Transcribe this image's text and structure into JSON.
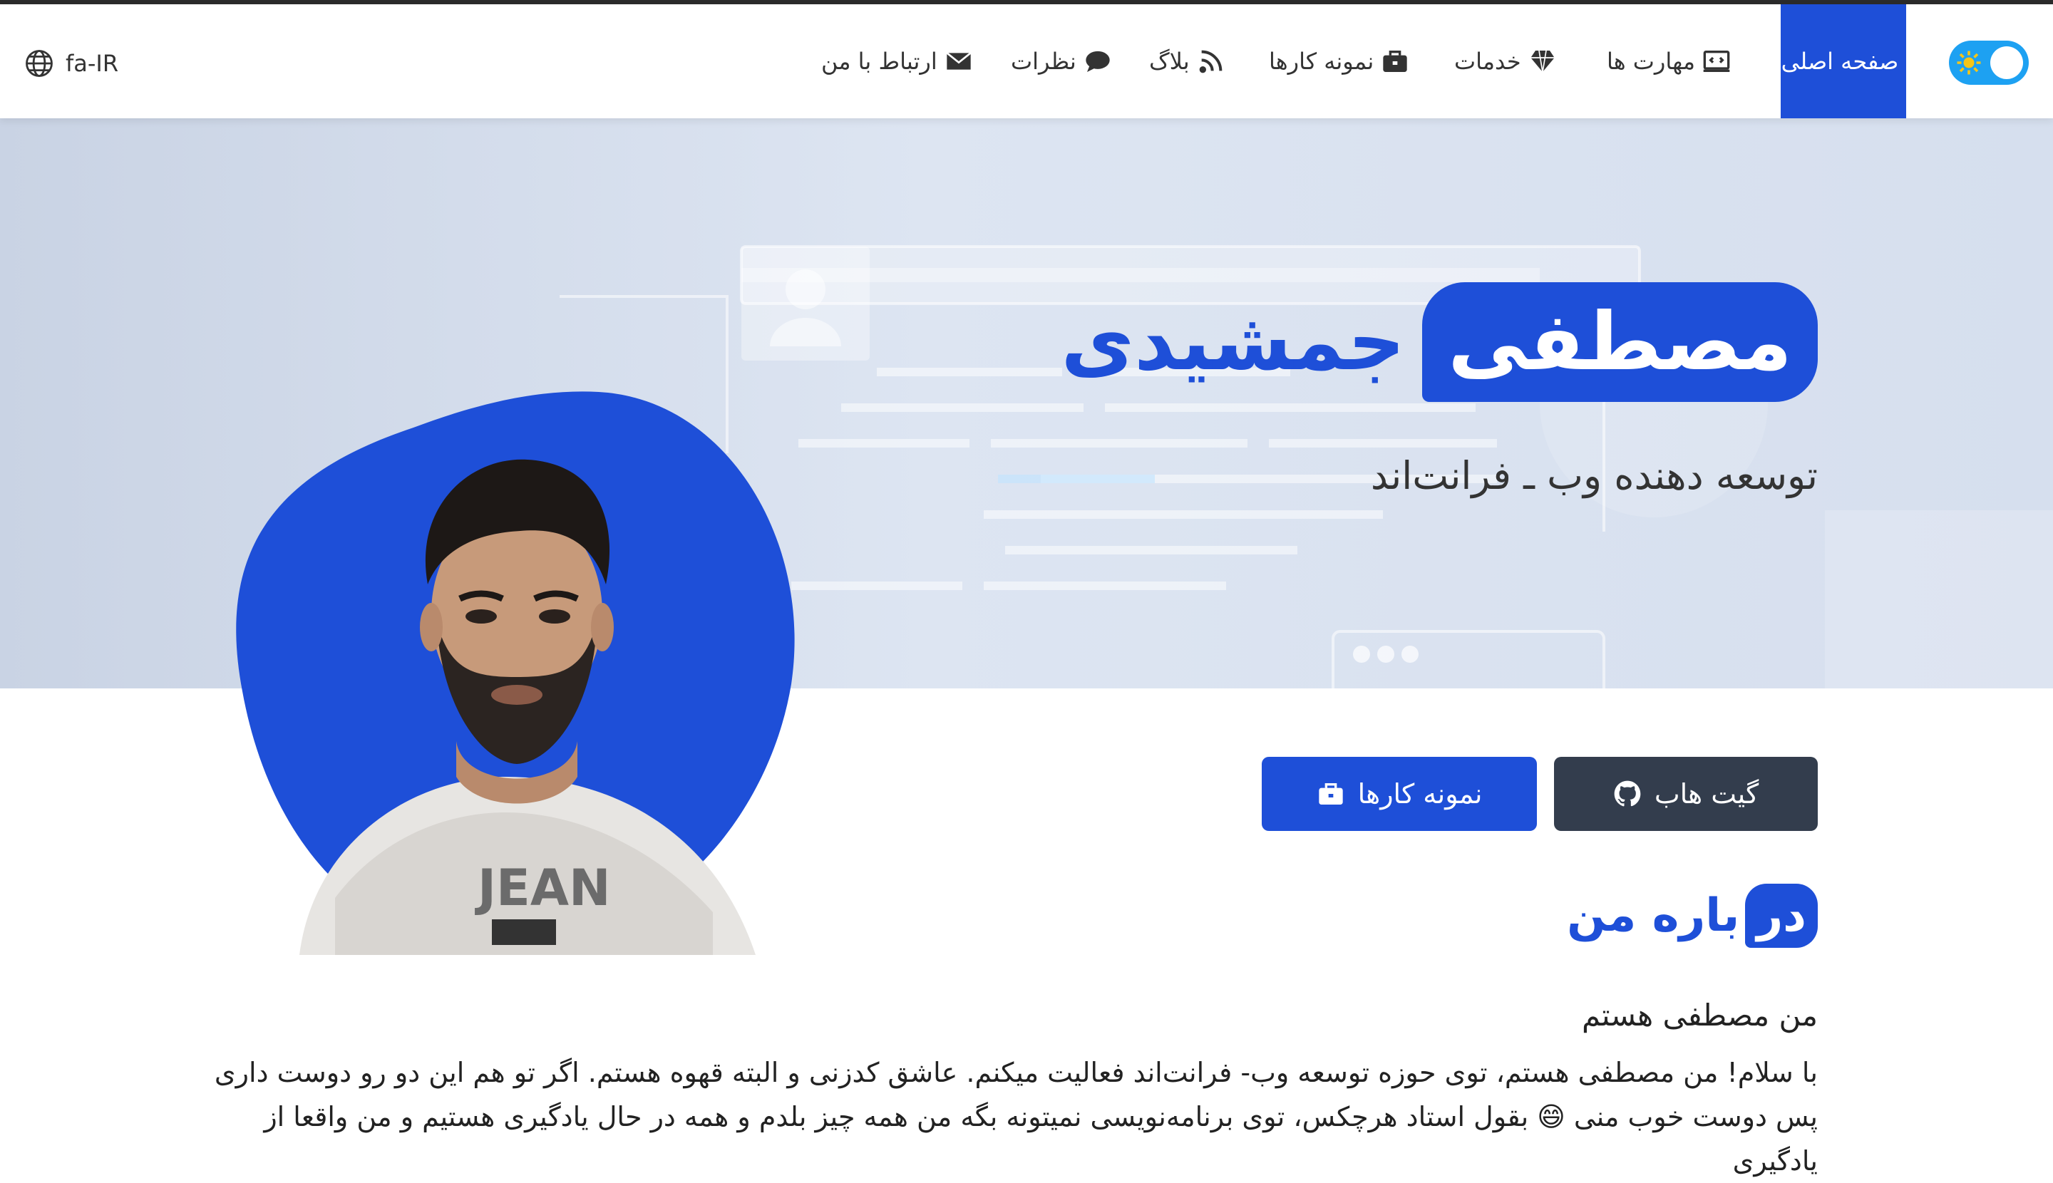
{
  "nav": {
    "lang": "fa-IR",
    "items": [
      {
        "label": "صفحه اصلی",
        "icon": "home-icon",
        "active": true
      },
      {
        "label": "مهارت ها",
        "icon": "code-window-icon"
      },
      {
        "label": "خدمات",
        "icon": "diamond-icon"
      },
      {
        "label": "نمونه کارها",
        "icon": "briefcase-icon"
      },
      {
        "label": "بلاگ",
        "icon": "rss-icon"
      },
      {
        "label": "نظرات",
        "icon": "comment-icon"
      },
      {
        "label": "ارتباط با من",
        "icon": "envelope-icon"
      }
    ],
    "theme_toggle_icon": "sun-icon"
  },
  "hero": {
    "name_highlight": "مصطفی",
    "name_rest": "جمشیدی",
    "subtitle": "توسعه دهنده وب ـ فرانت‌اند"
  },
  "buttons": {
    "github": "گیت هاب",
    "portfolio": "نمونه کارها"
  },
  "about": {
    "title_highlight": "در",
    "title_rest": "باره من",
    "subtitle": "من مصطفی هستم",
    "body": "با سلام! من مصطفی هستم، توی حوزه توسعه وب- فرانت‌اند فعالیت میکنم. عاشق کدزنی و البته قهوه هستم. اگر تو هم این دو رو دوست داری پس دوست خوب منی 😄 بقول استاد هرچکس، توی برنامه‌نویسی نمیتونه بگه من همه چیز بلدم و همه در حال یادگیری هستیم و من واقعا از یادگیری"
  },
  "colors": {
    "accent": "#1e4fd8",
    "dark_button": "#333d4d",
    "toggle": "#1da1f2"
  }
}
